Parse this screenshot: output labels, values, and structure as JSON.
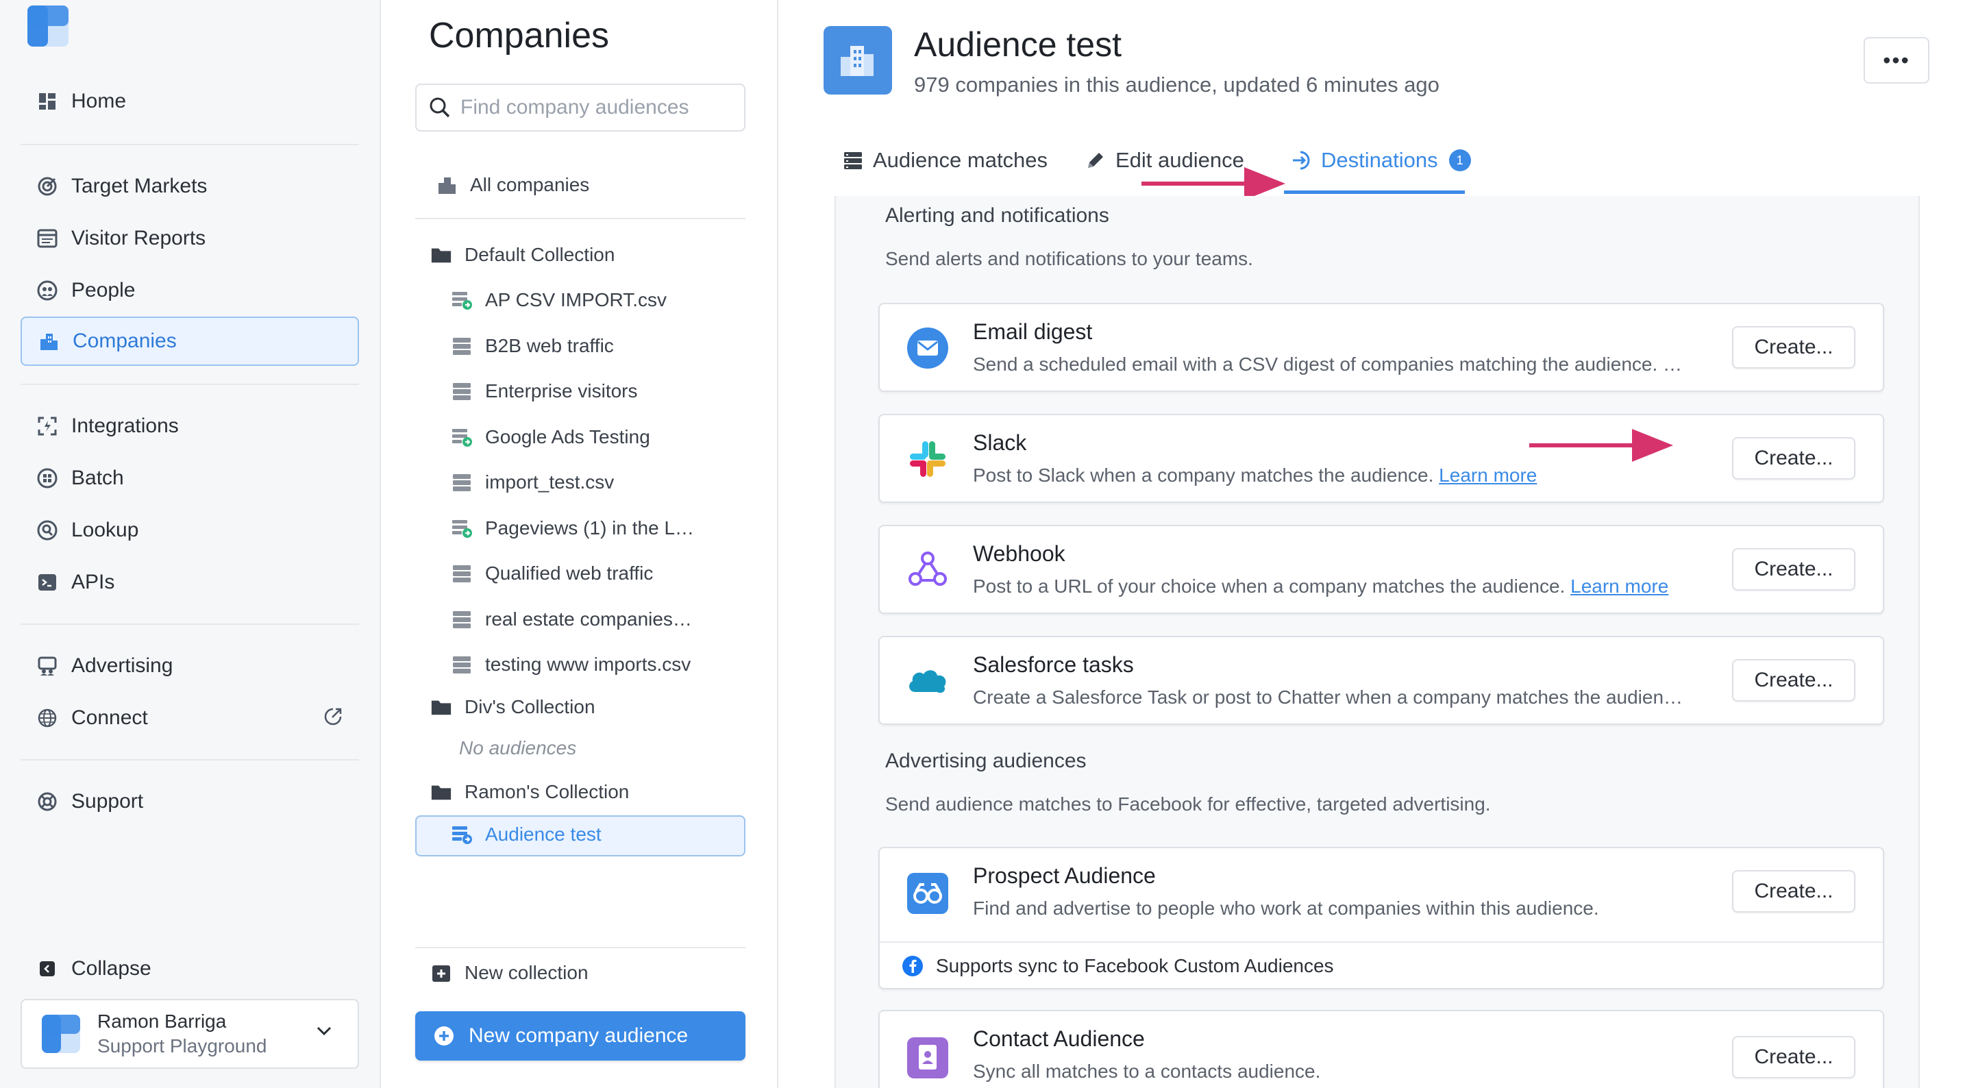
{
  "colors": {
    "accent": "#3a8ae6",
    "arrow": "#d6336c",
    "active_bg": "#eaf3ff"
  },
  "nav": {
    "items": [
      {
        "label": "Home",
        "icon": "home-grid-icon"
      },
      {
        "label": "Target Markets",
        "icon": "target-markets-icon"
      },
      {
        "label": "Visitor Reports",
        "icon": "visitor-reports-icon"
      },
      {
        "label": "People",
        "icon": "people-icon"
      },
      {
        "label": "Companies",
        "icon": "companies-icon",
        "active": true
      },
      {
        "label": "Integrations",
        "icon": "integrations-icon"
      },
      {
        "label": "Batch",
        "icon": "batch-icon"
      },
      {
        "label": "Lookup",
        "icon": "lookup-icon"
      },
      {
        "label": "APIs",
        "icon": "api-terminal-icon"
      },
      {
        "label": "Advertising",
        "icon": "advertising-icon"
      },
      {
        "label": "Connect",
        "icon": "globe-icon"
      },
      {
        "label": "Support",
        "icon": "lifebuoy-icon"
      }
    ],
    "collapse_label": "Collapse",
    "user": {
      "name": "Ramon Barriga",
      "org": "Support Playground"
    }
  },
  "mid": {
    "title": "Companies",
    "search_placeholder": "Find company audiences",
    "all_companies": "All companies",
    "collections": [
      {
        "name": "Default Collection",
        "audiences": [
          {
            "label": "AP CSV IMPORT.csv",
            "icon": "csv-import-icon"
          },
          {
            "label": "B2B web traffic",
            "icon": "list-icon"
          },
          {
            "label": "Enterprise visitors",
            "icon": "list-icon"
          },
          {
            "label": "Google Ads Testing",
            "icon": "csv-import-icon"
          },
          {
            "label": "import_test.csv",
            "icon": "list-icon"
          },
          {
            "label": "Pageviews (1) in the L…",
            "icon": "csv-import-icon"
          },
          {
            "label": "Qualified web traffic",
            "icon": "list-icon"
          },
          {
            "label": "real estate companies…",
            "icon": "list-icon"
          },
          {
            "label": "testing www imports.csv",
            "icon": "list-icon"
          }
        ]
      },
      {
        "name": "Div's Collection",
        "empty_label": "No audiences"
      },
      {
        "name": "Ramon's Collection",
        "audiences": [
          {
            "label": "Audience test",
            "icon": "csv-import-icon",
            "active": true
          }
        ]
      }
    ],
    "new_collection": "New collection",
    "new_audience_button": "New company audience"
  },
  "main": {
    "title": "Audience test",
    "subtitle": "979 companies in this audience, updated 6 minutes ago",
    "more_button": "•••",
    "tabs": [
      {
        "label": "Audience matches",
        "icon": "list-icon"
      },
      {
        "label": "Edit audience",
        "icon": "pencil-icon"
      },
      {
        "label": "Destinations",
        "icon": "destinations-icon",
        "badge": "1",
        "active": true
      }
    ],
    "sections": {
      "alerting": {
        "title": "Alerting and notifications",
        "description": "Send alerts and notifications to your teams."
      },
      "advertising": {
        "title": "Advertising audiences",
        "description": "Send audience matches to Facebook for effective, targeted advertising."
      }
    },
    "cards": [
      {
        "title": "Email digest",
        "description": "Send a scheduled email with a CSV digest of companies matching the audience. …",
        "button": "Create...",
        "icon": "email-icon"
      },
      {
        "title": "Slack",
        "description": "Post to Slack when a company matches the audience.",
        "link": "Learn more",
        "button": "Create...",
        "icon": "slack-icon"
      },
      {
        "title": "Webhook",
        "description": "Post to a URL of your choice when a company matches the audience.",
        "link": "Learn more",
        "button": "Create...",
        "icon": "webhook-icon"
      },
      {
        "title": "Salesforce tasks",
        "description": "Create a Salesforce Task or post to Chatter when a company matches the audien…",
        "button": "Create...",
        "icon": "salesforce-cloud-icon"
      },
      {
        "title": "Prospect Audience",
        "description": "Find and advertise to people who work at companies within this audience.",
        "button": "Create...",
        "icon": "binoculars-icon",
        "footer": "Supports sync to Facebook Custom Audiences"
      },
      {
        "title": "Contact Audience",
        "description": "Sync all matches to a contacts audience.",
        "button": "Create...",
        "icon": "contact-card-icon"
      }
    ]
  }
}
